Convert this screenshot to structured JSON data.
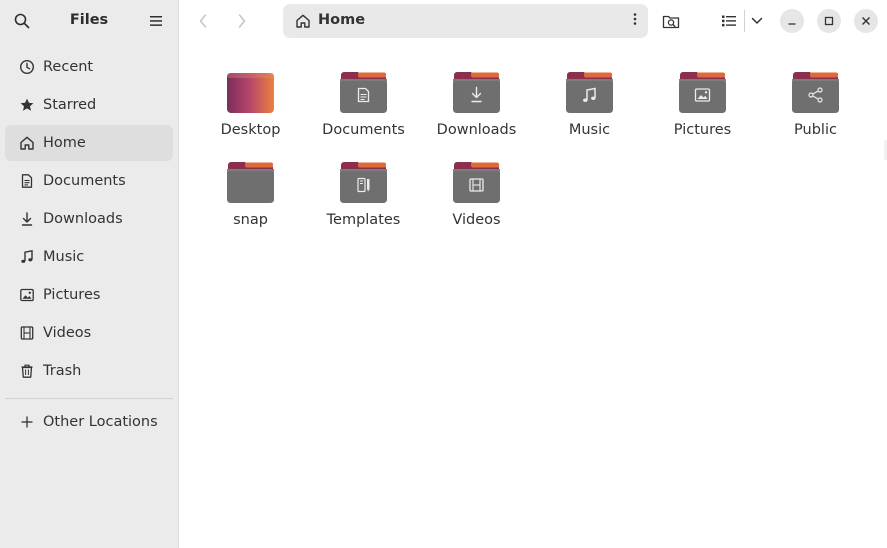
{
  "app": {
    "title": "Files"
  },
  "sidebar": {
    "items": [
      {
        "label": "Recent",
        "icon": "clock-icon"
      },
      {
        "label": "Starred",
        "icon": "star-icon"
      },
      {
        "label": "Home",
        "icon": "home-icon",
        "active": true
      },
      {
        "label": "Documents",
        "icon": "document-icon"
      },
      {
        "label": "Downloads",
        "icon": "download-icon"
      },
      {
        "label": "Music",
        "icon": "music-note-icon"
      },
      {
        "label": "Pictures",
        "icon": "picture-icon"
      },
      {
        "label": "Videos",
        "icon": "film-icon"
      },
      {
        "label": "Trash",
        "icon": "trash-icon"
      }
    ],
    "other_locations": {
      "label": "Other Locations",
      "icon": "plus-icon"
    }
  },
  "pathbar": {
    "location": "Home"
  },
  "files": [
    {
      "name": "Desktop",
      "emblem": "none",
      "variant": "desktop"
    },
    {
      "name": "Documents",
      "emblem": "document-emblem"
    },
    {
      "name": "Downloads",
      "emblem": "download-emblem"
    },
    {
      "name": "Music",
      "emblem": "music-emblem"
    },
    {
      "name": "Pictures",
      "emblem": "picture-emblem"
    },
    {
      "name": "Public",
      "emblem": "share-emblem"
    },
    {
      "name": "snap",
      "emblem": "none"
    },
    {
      "name": "Templates",
      "emblem": "template-emblem"
    },
    {
      "name": "Videos",
      "emblem": "film-emblem"
    }
  ],
  "colors": {
    "sidebar_bg": "#ebebeb",
    "active_item_bg": "#dedede",
    "folder_body": "#6f6f6f",
    "folder_tab": "#8b2f4f",
    "folder_tab_accent": "#e0693a"
  }
}
